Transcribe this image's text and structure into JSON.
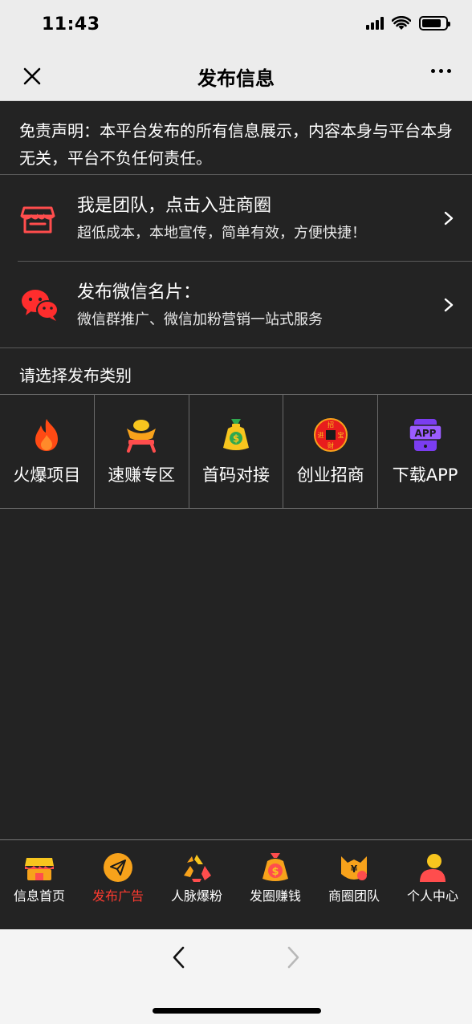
{
  "status_bar": {
    "time": "11:43"
  },
  "nav": {
    "title": "发布信息"
  },
  "disclaimer": {
    "text": "免责声明：本平台发布的所有信息展示，内容本身与平台本身无关，平台不负任何责任。"
  },
  "promos": [
    {
      "title": "我是团队，点击入驻商圈",
      "subtitle": "超低成本，本地宣传，简单有效，方便快捷！",
      "icon": "store-icon"
    },
    {
      "title": "发布微信名片：",
      "subtitle": "微信群推广、微信加粉营销一站式服务",
      "icon": "wechat-icon"
    }
  ],
  "category_section": {
    "label": "请选择发布类别",
    "items": [
      {
        "label": "火爆项目",
        "icon": "fire-icon"
      },
      {
        "label": "速赚专区",
        "icon": "gold-ingot-icon"
      },
      {
        "label": "首码对接",
        "icon": "money-bag-icon"
      },
      {
        "label": "创业招商",
        "icon": "coin-icon",
        "icon_text": [
          "招",
          "进",
          "宝",
          "财"
        ]
      },
      {
        "label": "下载APP",
        "icon": "app-download-icon",
        "icon_text": "APP"
      }
    ]
  },
  "tab_bar": {
    "items": [
      {
        "label": "信息首页",
        "icon": "shop-icon",
        "active": false
      },
      {
        "label": "发布广告",
        "icon": "send-icon",
        "active": true
      },
      {
        "label": "人脉爆粉",
        "icon": "recycle-icon",
        "active": false
      },
      {
        "label": "发圈赚钱",
        "icon": "money-bag-icon",
        "active": false
      },
      {
        "label": "商圈团队",
        "icon": "team-icon",
        "active": false
      },
      {
        "label": "个人中心",
        "icon": "user-icon",
        "active": false
      }
    ]
  },
  "colors": {
    "background": "#232323",
    "accent_red": "#ff3b30",
    "icon_orange": "#f7a21b",
    "icon_purple": "#7b3df0"
  }
}
